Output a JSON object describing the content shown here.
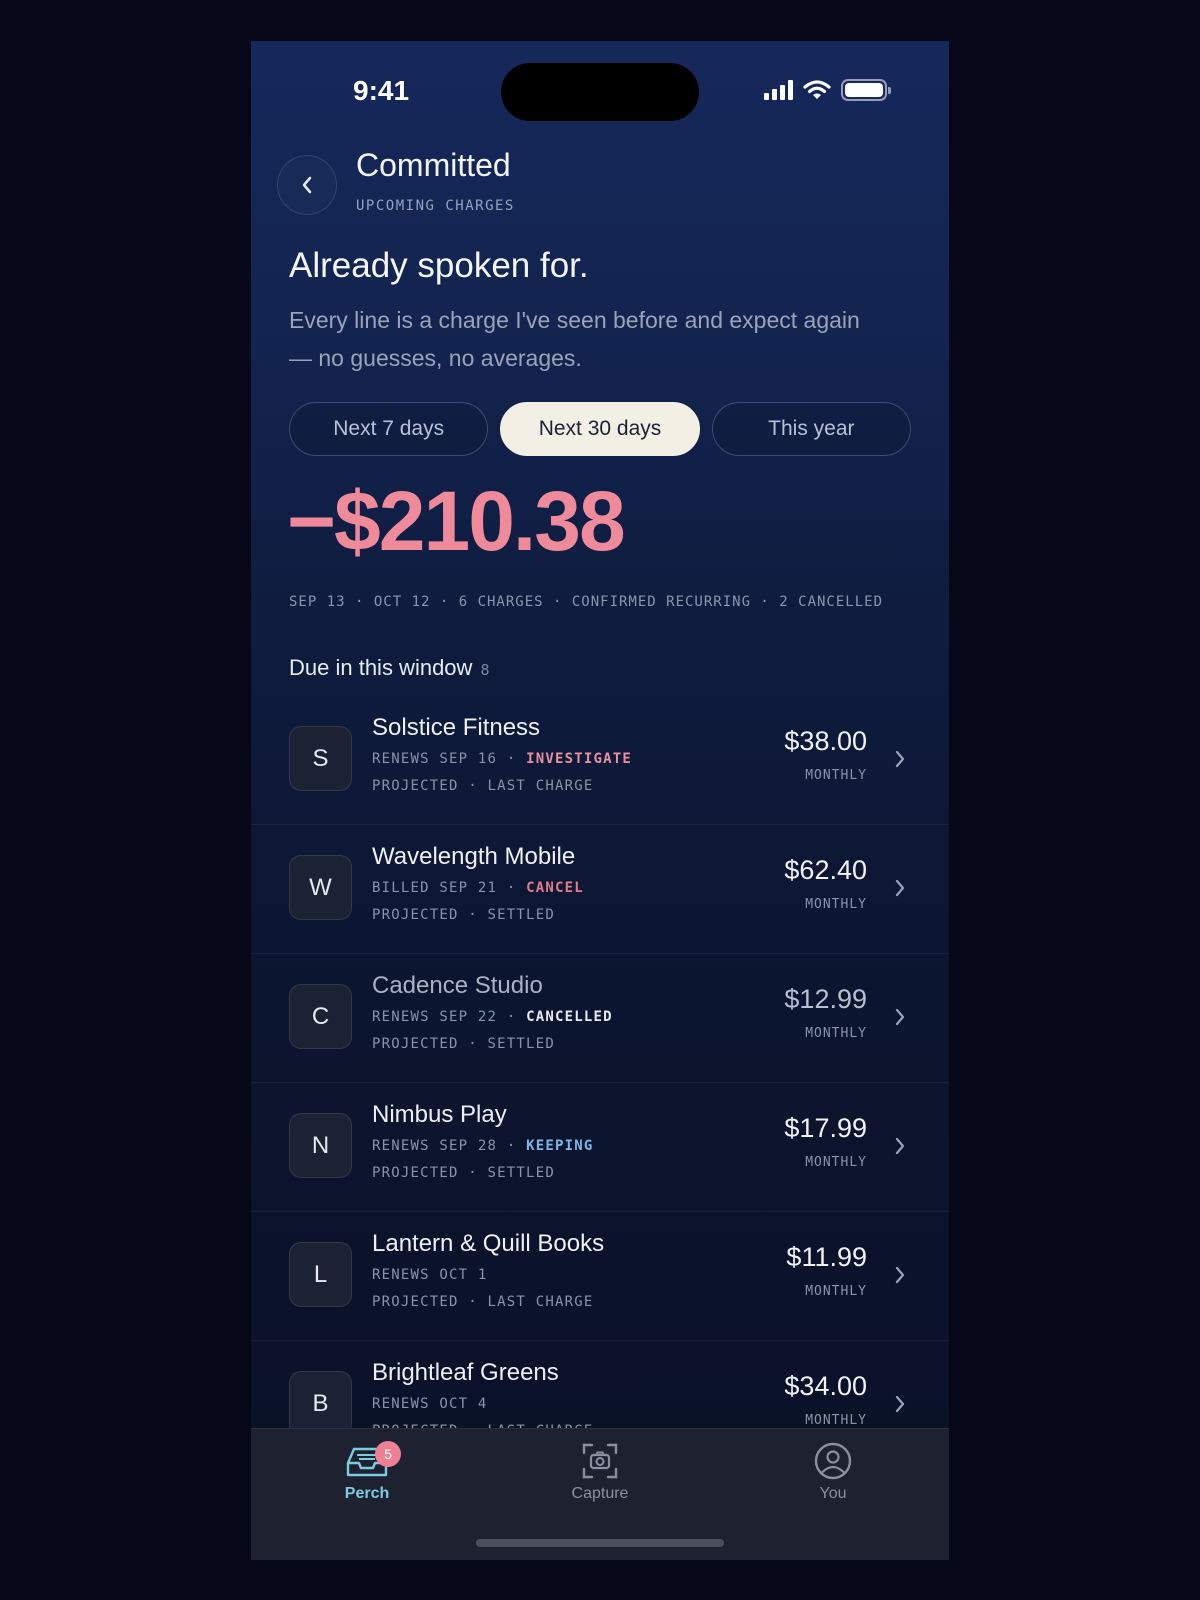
{
  "status_bar": {
    "time": "9:41"
  },
  "header": {
    "title": "Committed",
    "subtitle": "UPCOMING CHARGES"
  },
  "headline": "Already spoken for.",
  "description": "Every line is a charge I've seen before and expect again — no guesses, no averages.",
  "range_tabs": [
    {
      "label": "Next 7 days",
      "active": false
    },
    {
      "label": "Next 30 days",
      "active": true
    },
    {
      "label": "This year",
      "active": false
    }
  ],
  "total": "−$210.38",
  "summary_meta": "SEP 13 · OCT 12 · 6 CHARGES · CONFIRMED RECURRING · 2 CANCELLED",
  "section": {
    "title": "Due in this window",
    "count": "8"
  },
  "colors": {
    "negative": "#ef8a9a",
    "investigate": "#e8919c",
    "cancel": "#e07d8a",
    "cancelled": "#e6e9f2",
    "keeping": "#7eb6e6",
    "active_nav": "#7ecbe1"
  },
  "charges": [
    {
      "initial": "S",
      "name": "Solstice Fitness",
      "date": "RENEWS SEP 16",
      "tag": "INVESTIGATE",
      "tag_color": "#e8919c",
      "detail": "PROJECTED · LAST CHARGE",
      "amount": "$38.00",
      "period": "MONTHLY"
    },
    {
      "initial": "W",
      "name": "Wavelength Mobile",
      "date": "BILLED SEP 21",
      "tag": "CANCEL",
      "tag_color": "#e07d8a",
      "detail": "PROJECTED · SETTLED",
      "amount": "$62.40",
      "period": "MONTHLY"
    },
    {
      "initial": "C",
      "name": "Cadence Studio",
      "date": "RENEWS SEP 22",
      "tag": "CANCELLED",
      "tag_color": "#e6e9f2",
      "detail": "PROJECTED · SETTLED",
      "amount": "$12.99",
      "period": "MONTHLY",
      "dim": true
    },
    {
      "initial": "N",
      "name": "Nimbus Play",
      "date": "RENEWS SEP 28",
      "tag": "KEEPING",
      "tag_color": "#7eb6e6",
      "detail": "PROJECTED · SETTLED",
      "amount": "$17.99",
      "period": "MONTHLY"
    },
    {
      "initial": "L",
      "name": "Lantern & Quill Books",
      "date": "RENEWS OCT 1",
      "tag": "",
      "tag_color": "",
      "detail": "PROJECTED · LAST CHARGE",
      "amount": "$11.99",
      "period": "MONTHLY"
    },
    {
      "initial": "B",
      "name": "Brightleaf Greens",
      "date": "RENEWS OCT 4",
      "tag": "",
      "tag_color": "",
      "detail": "PROJECTED · LAST CHARGE",
      "amount": "$34.00",
      "period": "MONTHLY"
    }
  ],
  "tab_bar": [
    {
      "label": "Perch",
      "icon": "inbox-tray-icon",
      "active": true,
      "badge": "5"
    },
    {
      "label": "Capture",
      "icon": "camera-scan-icon",
      "active": false
    },
    {
      "label": "You",
      "icon": "user-circle-icon",
      "active": false
    }
  ]
}
